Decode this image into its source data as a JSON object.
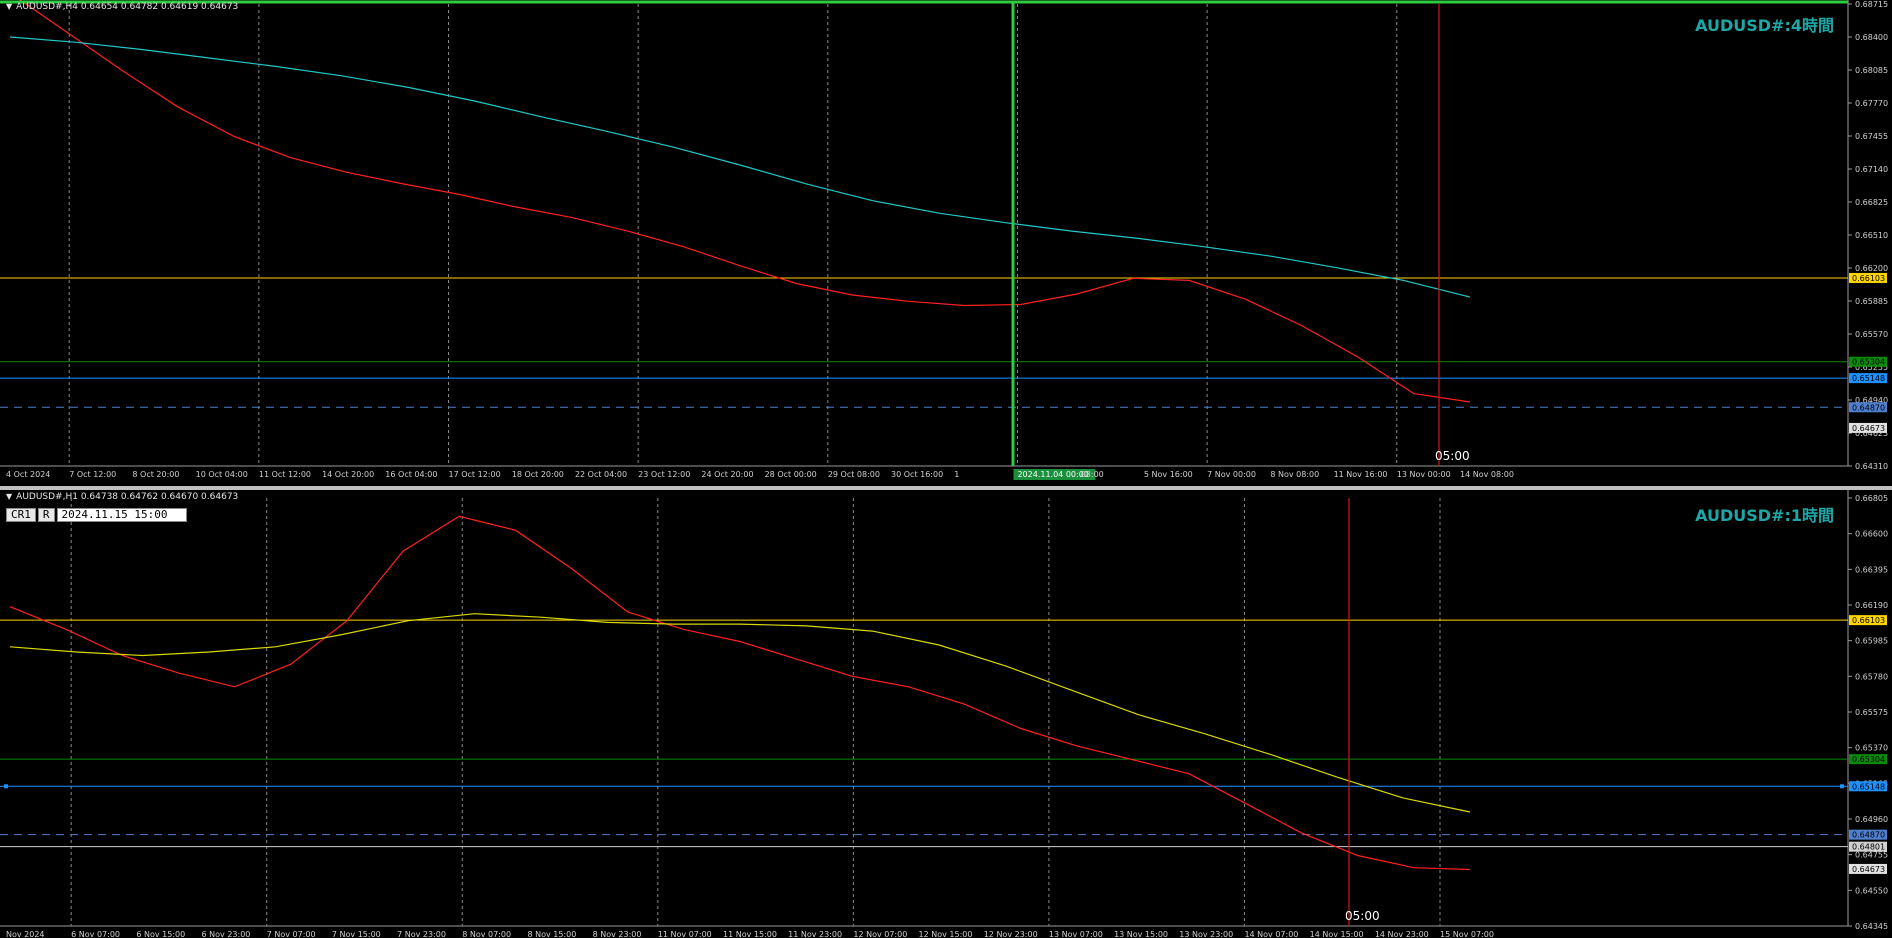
{
  "chart_data": [
    {
      "type": "line",
      "panel": "H4",
      "header": "AUDUSD#,H4  0.64654 0.64782 0.64619 0.64673",
      "title": "AUDUSD#:4時間",
      "ylim": [
        0.6431,
        0.68715
      ],
      "y_ticks": [
        "0.68715",
        "0.68400",
        "0.68085",
        "0.67770",
        "0.67455",
        "0.67140",
        "0.66825",
        "0.66510",
        "0.66200",
        "0.65885",
        "0.65570",
        "0.65255",
        "0.64940",
        "0.64625",
        "0.64310"
      ],
      "x_ticks": [
        "4 Oct 2024",
        "7 Oct 12:00",
        "8 Oct 20:00",
        "10 Oct 04:00",
        "11 Oct 12:00",
        "14 Oct 20:00",
        "16 Oct 04:00",
        "17 Oct 12:00",
        "18 Oct 20:00",
        "22 Oct 04:00",
        "23 Oct 12:00",
        "24 Oct 20:00",
        "28 Oct 00:00",
        "29 Oct 08:00",
        "30 Oct 16:00",
        "1",
        "2024.11.04 00:00",
        "08:00",
        "5 Nov 16:00",
        "7 Nov 00:00",
        "8 Nov 08:00",
        "11 Nov 16:00",
        "13 Nov 00:00",
        "14 Nov 08:00"
      ],
      "crosshair_time_label": "2024.11.04 00:00",
      "marker_label": "05:00",
      "hlines": [
        {
          "value": 0.66103,
          "label": "0.66103",
          "color": "#ffd500",
          "style": "solid"
        },
        {
          "value": 0.65304,
          "label": "0.65304",
          "color": "#0b8a0b",
          "style": "solid"
        },
        {
          "value": 0.65148,
          "label": "0.65148",
          "color": "#1e90ff",
          "style": "solid"
        },
        {
          "value": 0.6487,
          "label": "0.64870",
          "color": "#4f7fcf",
          "style": "dashed"
        }
      ],
      "current_price_label": "0.64673",
      "series": [
        {
          "name": "",
          "color": "#ff2020",
          "values": [
            0.6882,
            0.6845,
            0.6808,
            0.6773,
            0.6745,
            0.6725,
            0.6711,
            0.67,
            0.669,
            0.6678,
            0.6668,
            0.6655,
            0.664,
            0.6622,
            0.6605,
            0.6594,
            0.6588,
            0.6584,
            0.6585,
            0.6595,
            0.661,
            0.6608,
            0.659,
            0.6565,
            0.6535,
            0.65,
            0.6492
          ]
        },
        {
          "name": "",
          "color": "#20c8c8",
          "values": [
            0.684,
            0.6835,
            0.6828,
            0.682,
            0.6812,
            0.6803,
            0.6792,
            0.6779,
            0.6764,
            0.675,
            0.6735,
            0.6718,
            0.67,
            0.6684,
            0.6672,
            0.6663,
            0.6655,
            0.6648,
            0.664,
            0.6631,
            0.662,
            0.6608,
            0.6592
          ]
        }
      ]
    },
    {
      "type": "line",
      "panel": "H1",
      "header": "AUDUSD#,H1  0.64738 0.64762 0.64670 0.64673",
      "title": "AUDUSD#:1時間",
      "crosshair_box": {
        "cr": "CR1",
        "r": "R",
        "datetime": "2024.11.15 15:00"
      },
      "ylim": [
        0.64345,
        0.66805
      ],
      "y_ticks": [
        "0.66805",
        "0.66600",
        "0.66395",
        "0.66190",
        "0.65985",
        "0.65780",
        "0.65575",
        "0.65370",
        "0.65165",
        "0.64960",
        "0.64755",
        "0.64550",
        "0.64345"
      ],
      "x_ticks": [
        "Nov 2024",
        "6 Nov 07:00",
        "6 Nov 15:00",
        "6 Nov 23:00",
        "7 Nov 07:00",
        "7 Nov 15:00",
        "7 Nov 23:00",
        "8 Nov 07:00",
        "8 Nov 15:00",
        "8 Nov 23:00",
        "11 Nov 07:00",
        "11 Nov 15:00",
        "11 Nov 23:00",
        "12 Nov 07:00",
        "12 Nov 15:00",
        "12 Nov 23:00",
        "13 Nov 07:00",
        "13 Nov 15:00",
        "13 Nov 23:00",
        "14 Nov 07:00",
        "14 Nov 15:00",
        "14 Nov 23:00",
        "15 Nov 07:00"
      ],
      "marker_label": "05:00",
      "hlines": [
        {
          "value": 0.66103,
          "label": "0.66103",
          "color": "#ffd500",
          "style": "solid"
        },
        {
          "value": 0.65304,
          "label": "0.65304",
          "color": "#0b8a0b",
          "style": "solid"
        },
        {
          "value": 0.65148,
          "label": "0.65148",
          "color": "#1e90ff",
          "style": "solid"
        },
        {
          "value": 0.6487,
          "label": "0.64870",
          "color": "#4f7fcf",
          "style": "dashed"
        },
        {
          "value": 0.64801,
          "label": "0.64801",
          "color": "#d0d0d0",
          "style": "solid"
        }
      ],
      "current_price_label": "0.64673",
      "series": [
        {
          "name": "",
          "color": "#ff2020",
          "values": [
            0.6618,
            0.6605,
            0.659,
            0.658,
            0.6572,
            0.6585,
            0.661,
            0.665,
            0.667,
            0.6662,
            0.664,
            0.6615,
            0.6605,
            0.6598,
            0.6588,
            0.6578,
            0.6572,
            0.6562,
            0.6548,
            0.6538,
            0.653,
            0.6522,
            0.6505,
            0.6488,
            0.6475,
            0.6468,
            0.6467
          ]
        },
        {
          "name": "",
          "color": "#d8d800",
          "values": [
            0.6595,
            0.6592,
            0.659,
            0.6592,
            0.6595,
            0.6602,
            0.661,
            0.6614,
            0.6612,
            0.6609,
            0.6608,
            0.6608,
            0.6607,
            0.6604,
            0.6596,
            0.6584,
            0.657,
            0.6556,
            0.6545,
            0.6533,
            0.652,
            0.6508,
            0.65
          ]
        }
      ]
    }
  ]
}
